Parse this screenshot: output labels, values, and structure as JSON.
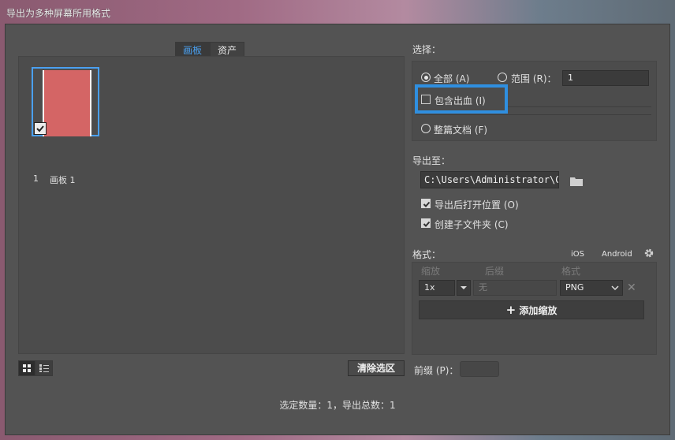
{
  "window": {
    "title": "导出为多种屏幕所用格式"
  },
  "tabs": [
    {
      "label": "画板",
      "active": true
    },
    {
      "label": "资产",
      "active": false
    }
  ],
  "artboard": {
    "number": "1",
    "name": "画板 1",
    "fill": "#d46565",
    "selected": true
  },
  "selection": {
    "heading": "选择：",
    "all_label": "全部 (A)",
    "range_label": "范围 (R)：",
    "range_value": "1",
    "bleed_label": "包含出血 (I)",
    "whole_doc_label": "整篇文档 (F)",
    "selected_option": "all"
  },
  "export_to": {
    "heading": "导出至：",
    "path": "C:\\Users\\Administrator\\C",
    "open_after_label": "导出后打开位置 (O)",
    "open_after_checked": true,
    "create_subfolders_label": "创建子文件夹 (C)",
    "create_subfolders_checked": true
  },
  "formats": {
    "heading": "格式：",
    "ios_label": "iOS",
    "android_label": "Android",
    "columns": {
      "scale": "缩放",
      "suffix": "后缀",
      "format": "格式"
    },
    "row": {
      "scale": "1x",
      "suffix_placeholder": "无",
      "format": "PNG"
    },
    "add_scale_label": "添加缩放"
  },
  "footer": {
    "clear_selection_label": "清除选区",
    "prefix_label": "前缀 (P)：",
    "status": "选定数量：1，导出总数：1"
  },
  "colors": {
    "accent": "#4aa0f0",
    "highlight": "#2f8fe0",
    "dialog_bg": "#535353"
  }
}
